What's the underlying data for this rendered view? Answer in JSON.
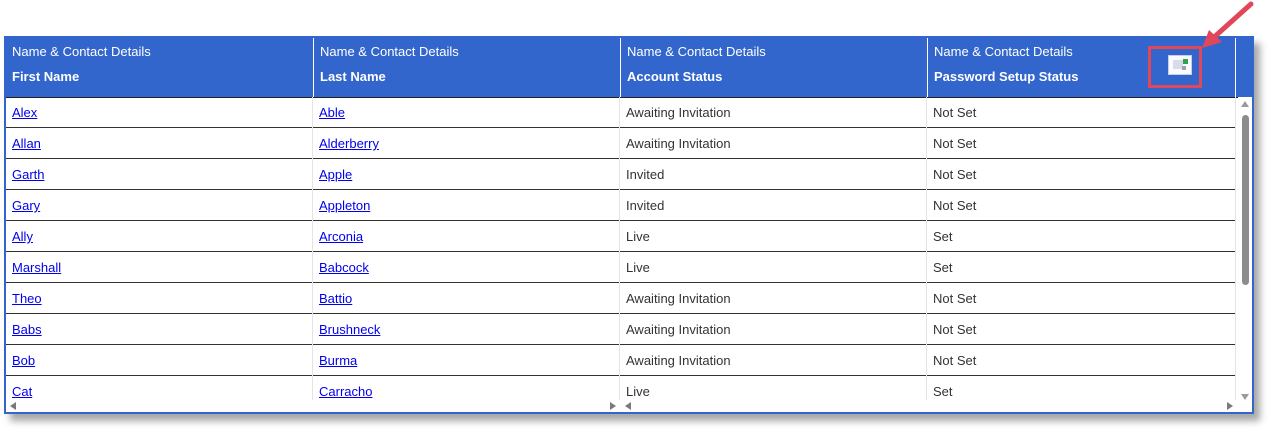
{
  "header": {
    "columns": [
      {
        "group": "Name & Contact Details",
        "label": "First Name"
      },
      {
        "group": "Name & Contact Details",
        "label": "Last Name"
      },
      {
        "group": "Name & Contact Details",
        "label": "Account Status"
      },
      {
        "group": "Name & Contact Details",
        "label": "Password Setup Status"
      }
    ],
    "chooser_icon": "column-chooser-icon"
  },
  "rows": [
    {
      "first": "Alex",
      "last": "Able",
      "account": "Awaiting Invitation",
      "password": "Not Set"
    },
    {
      "first": "Allan",
      "last": "Alderberry",
      "account": "Awaiting Invitation",
      "password": "Not Set"
    },
    {
      "first": "Garth",
      "last": "Apple",
      "account": "Invited",
      "password": "Not Set"
    },
    {
      "first": "Gary",
      "last": "Appleton",
      "account": "Invited",
      "password": "Not Set"
    },
    {
      "first": "Ally",
      "last": "Arconia",
      "account": "Live",
      "password": "Set"
    },
    {
      "first": "Marshall",
      "last": "Babcock",
      "account": "Live",
      "password": "Set"
    },
    {
      "first": "Theo",
      "last": "Battio",
      "account": "Awaiting Invitation",
      "password": "Not Set"
    },
    {
      "first": "Babs",
      "last": "Brushneck",
      "account": "Awaiting Invitation",
      "password": "Not Set"
    },
    {
      "first": "Bob",
      "last": "Burma",
      "account": "Awaiting Invitation",
      "password": "Not Set"
    },
    {
      "first": "Cat",
      "last": "Carracho",
      "account": "Live",
      "password": "Set"
    }
  ],
  "colors": {
    "header_bg": "#3366cc",
    "link": "#0000ee",
    "annotation": "#e0485a"
  }
}
